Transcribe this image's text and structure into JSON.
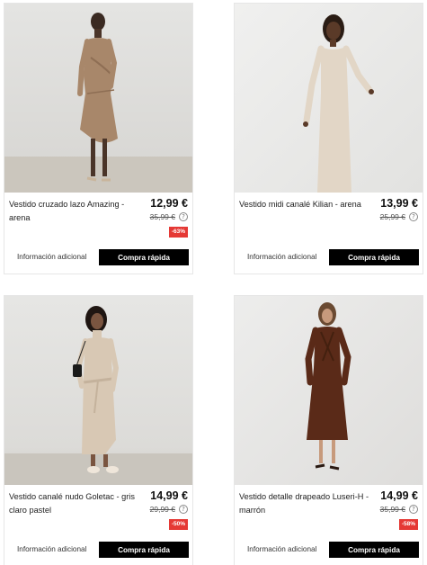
{
  "products": [
    {
      "name": "Vestido cruzado lazo Amazing - arena",
      "price": "12,99 €",
      "old_price": "35,99 €",
      "discount": "-63%",
      "info_label": "Información adicional",
      "buy_label": "Compra rápida",
      "help_icon": "?"
    },
    {
      "name": "Vestido midi canalé Kilian - arena",
      "price": "13,99 €",
      "old_price": "25,99 €",
      "discount": "",
      "info_label": "Información adicional",
      "buy_label": "Compra rápida",
      "help_icon": "?"
    },
    {
      "name": "Vestido canalé nudo Goletac - gris claro pastel",
      "price": "14,99 €",
      "old_price": "29,99 €",
      "discount": "-50%",
      "info_label": "Información adicional",
      "buy_label": "Compra rápida",
      "help_icon": "?"
    },
    {
      "name": "Vestido detalle drapeado Luseri-H - marrón",
      "price": "14,99 €",
      "old_price": "35,99 €",
      "discount": "-58%",
      "info_label": "Información adicional",
      "buy_label": "Compra rápida",
      "help_icon": "?"
    }
  ],
  "colors": {
    "discount_bg": "#e53935",
    "button_bg": "#000000",
    "dress_arena_wrap": "#a8876a",
    "dress_arena_midi": "#e2d6c6",
    "dress_gris": "#d8c8b4",
    "dress_marron": "#5a2a18"
  }
}
